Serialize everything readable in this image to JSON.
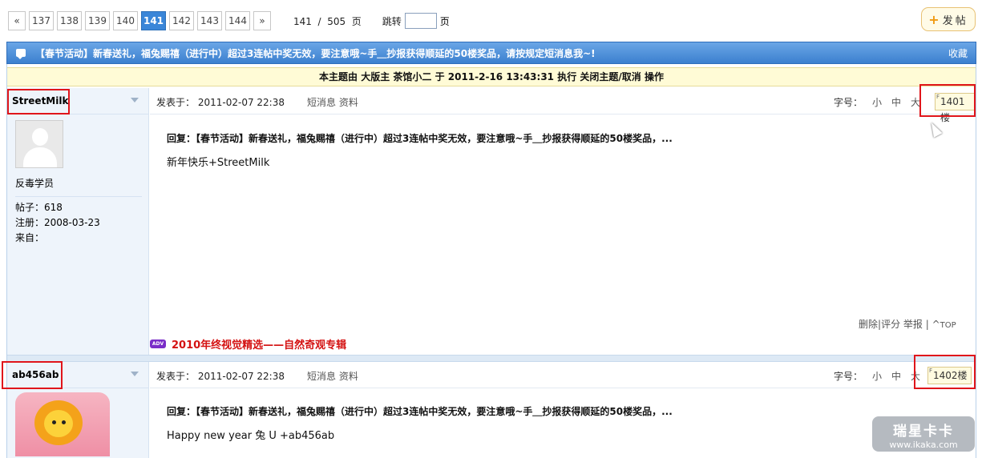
{
  "pager": {
    "prev": "«",
    "pages": [
      "137",
      "138",
      "139",
      "140",
      "141",
      "142",
      "143",
      "144"
    ],
    "current": "141",
    "next": "»",
    "page_info": "141  /  505  页",
    "jump_label": "跳转",
    "jump_suffix": "页"
  },
  "post_button": {
    "plus": "+",
    "label": "发帖"
  },
  "thread": {
    "title": "【春节活动】新春送礼，福兔赐禧（进行中）超过3连帖中奖无效，要注意哦~手＿抄报获得顺延的50楼奖品，请按规定短消息我~!",
    "favorite": "收藏",
    "mod_notice": "本主题由 大版主 茶馆小二 于 2011-2-16 13:43:31 执行 关闭主题/取消 操作"
  },
  "post_common": {
    "posted_prefix": "发表于：",
    "pm_link": "短消息",
    "profile_link": "资料",
    "font_size_label": "字号：",
    "font_small": "小",
    "font_medium": "中",
    "font_large": "大",
    "reply_title": "回复：【春节活动】新春送礼，福兔赐禧（进行中）超过3连帖中奖无效，要注意哦~手＿抄报获得顺延的50楼奖品，..."
  },
  "posts": [
    {
      "username": "StreetMilk",
      "posted_at": "2011-02-07 22:38",
      "floor": "1401楼",
      "user_group": "反毒学员",
      "posts_count": "帖子：618",
      "register": "注册：2008-03-23",
      "from": "来自：",
      "content": "新年快乐+StreetMilk",
      "actions": {
        "delete": "删除",
        "rate": "评分",
        "report": "举报",
        "top": "TOP"
      }
    },
    {
      "username": "ab456ab",
      "posted_at": "2011-02-07 22:38",
      "floor": "1402楼",
      "content": "Happy new year 兔 U +ab456ab"
    }
  ],
  "ad": {
    "badge": "ADV",
    "text": "2010年终视觉精选——自然奇观专辑"
  },
  "watermark": {
    "line1": "瑞星卡卡",
    "line2": "www.ikaka.com"
  },
  "colors": {
    "accent_blue": "#3c80cf",
    "highlight_red": "#e0151b",
    "ad_red": "#d41212",
    "notice_bg": "#fffbd6"
  }
}
